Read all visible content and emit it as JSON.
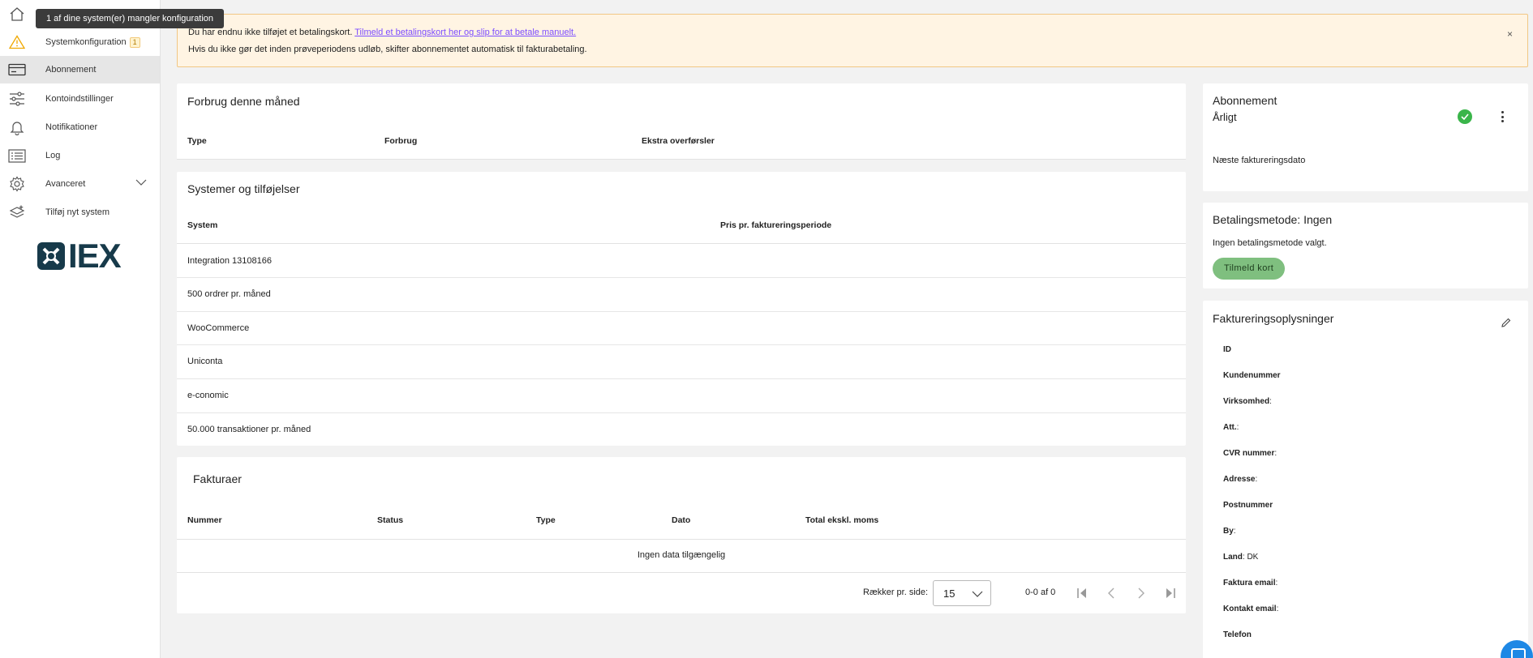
{
  "tooltip": "1 af dine system(er) mangler konfiguration",
  "sidebar": {
    "items": [
      {
        "label": "",
        "icon": "home-icon"
      },
      {
        "label": "Systemkonfiguration",
        "badge": "1",
        "icon": "warning-icon"
      },
      {
        "label": "Abonnement",
        "icon": "card-icon"
      },
      {
        "label": "Kontoindstillinger",
        "icon": "sliders-icon"
      },
      {
        "label": "Notifikationer",
        "icon": "bell-icon"
      },
      {
        "label": "Log",
        "icon": "list-icon"
      },
      {
        "label": "Avanceret",
        "icon": "gear-icon"
      },
      {
        "label": "Tilføj nyt system",
        "icon": "layers-add-icon"
      }
    ],
    "logo_text": "IEX"
  },
  "banner": {
    "line1_prefix": "Du har endnu ikke tilføjet et betalingskort.",
    "line1_link": "Tilmeld et betalingskort her og slip for at betale manuelt.",
    "line2": "Hvis du ikke gør det inden prøveperiodens udløb, skifter abonnementet automatisk til fakturabetaling.",
    "close": "×"
  },
  "usage": {
    "title": "Forbrug denne måned",
    "headers": [
      "Type",
      "Forbrug",
      "Ekstra overførsler"
    ]
  },
  "systems": {
    "title": "Systemer og tilføjelser",
    "headers": [
      "System",
      "Pris pr. faktureringsperiode"
    ],
    "rows": [
      "Integration 13108166",
      "500 ordrer pr. måned",
      "WooCommerce",
      "Uniconta",
      "e-conomic",
      "50.000 transaktioner pr. måned"
    ]
  },
  "invoices": {
    "title": "Fakturaer",
    "headers": [
      "Nummer",
      "Status",
      "Type",
      "Dato",
      "Total ekskl. moms"
    ],
    "empty": "Ingen data tilgængelig",
    "rows_per_page_label": "Rækker pr. side:",
    "rows_per_page_value": "15",
    "range": "0-0 af 0"
  },
  "subscription": {
    "title": "Abonnement",
    "plan": "Årligt",
    "next_billing_label": "Næste faktureringsdato",
    "status_color": "#3ab54a"
  },
  "payment": {
    "title": "Betalingsmetode: Ingen",
    "text": "Ingen betalingsmetode valgt.",
    "button": "Tilmeld kort"
  },
  "billing": {
    "title": "Faktureringsoplysninger",
    "fields": [
      {
        "label": "ID",
        "value": ""
      },
      {
        "label": "Kundenummer",
        "value": ""
      },
      {
        "label": "Virksomhed",
        "value": ""
      },
      {
        "label": "Att.",
        "value": ""
      },
      {
        "label": "CVR nummer",
        "value": ""
      },
      {
        "label": "Adresse",
        "value": ""
      },
      {
        "label": "Postnummer",
        "value": ""
      },
      {
        "label": "By",
        "value": ""
      },
      {
        "label": "Land",
        "value": "DK"
      },
      {
        "label": "Faktura email",
        "value": ""
      },
      {
        "label": "Kontakt email",
        "value": ""
      },
      {
        "label": "Telefon",
        "value": ""
      }
    ]
  }
}
